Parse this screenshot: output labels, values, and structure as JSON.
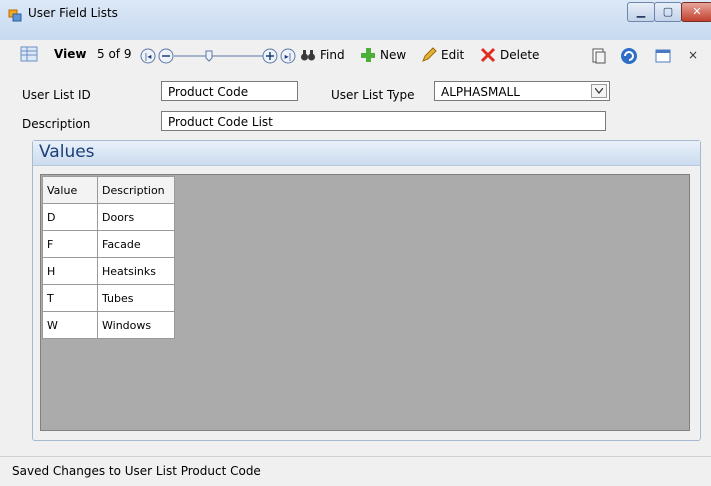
{
  "window": {
    "title": "User Field Lists"
  },
  "toolbar": {
    "view_label": "View",
    "record_counter": "5 of 9",
    "find_label": "Find",
    "new_label": "New",
    "edit_label": "Edit",
    "delete_label": "Delete"
  },
  "form": {
    "user_list_id_label": "User List ID",
    "user_list_id_value": "Product Code",
    "user_list_type_label": "User List Type",
    "user_list_type_value": "ALPHASMALL",
    "description_label": "Description",
    "description_value": "Product Code List"
  },
  "values_group": {
    "title": "Values",
    "columns": [
      "Value",
      "Description"
    ],
    "rows": [
      [
        "D",
        "Doors"
      ],
      [
        "F",
        "Facade"
      ],
      [
        "H",
        "Heatsinks"
      ],
      [
        "T",
        "Tubes"
      ],
      [
        "W",
        "Windows"
      ]
    ]
  },
  "status": {
    "text": "Saved Changes to User List Product Code"
  }
}
